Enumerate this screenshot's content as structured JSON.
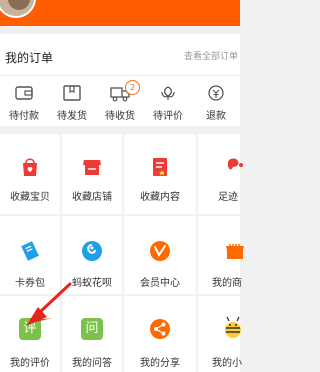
{
  "colors": {
    "brand_orange": "#ff5d00",
    "icon_red": "#ef3b36",
    "icon_blue": "#1e9fe8",
    "icon_green": "#7cc14a",
    "icon_orange": "#ff6a00",
    "arrow_red": "#e8241f"
  },
  "orders": {
    "title": "我的订单",
    "view_all": "查看全部订单",
    "items": [
      {
        "label": "待付款",
        "icon": "wallet-icon"
      },
      {
        "label": "待发货",
        "icon": "package-icon"
      },
      {
        "label": "待收货",
        "icon": "truck-icon",
        "badge": "2"
      },
      {
        "label": "待评价",
        "icon": "flower-icon"
      },
      {
        "label": "退款",
        "icon": "refund-icon"
      }
    ]
  },
  "grid": {
    "row1": [
      {
        "label": "收藏宝贝",
        "icon": "heart-bag-icon"
      },
      {
        "label": "收藏店铺",
        "icon": "store-icon"
      },
      {
        "label": "收藏内容",
        "icon": "bookmark-icon"
      },
      {
        "label": "足迹",
        "icon": "footprint-icon"
      }
    ],
    "row2": [
      {
        "label": "卡券包",
        "icon": "ticket-icon"
      },
      {
        "label": "蚂蚁花呗",
        "icon": "huabei-icon"
      },
      {
        "label": "会员中心",
        "icon": "member-icon"
      },
      {
        "label": "我的商",
        "icon": "shop-icon"
      }
    ],
    "row3": [
      {
        "label": "我的评价",
        "icon": "review-icon",
        "icon_text": "评"
      },
      {
        "label": "我的问答",
        "icon": "qa-icon",
        "icon_text": "问"
      },
      {
        "label": "我的分享",
        "icon": "share-icon"
      },
      {
        "label": "我的小",
        "icon": "bee-icon"
      }
    ]
  }
}
